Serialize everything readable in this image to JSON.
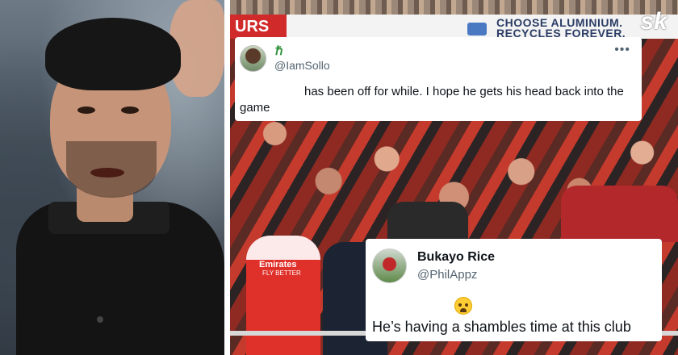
{
  "tweets": [
    {
      "badge": "ℏ",
      "handle": "@IamSollo",
      "more_label": "•••",
      "text": "has been off for while. I hope he gets his head back into the game"
    },
    {
      "name": "Bukayo Rice",
      "handle": "@PhilAppz",
      "emoji": "loudly-crying-face-icon",
      "text": "He’s having a shambles time at this club"
    }
  ],
  "background": {
    "banner_left_text": "URS",
    "banner_text": "CHOOSE ALUMINIUM. RECYCLES FOREVER.",
    "logo_text": "sk",
    "shirt_sponsor": "Emirates",
    "shirt_sponsor_line2": "FLY BETTER"
  },
  "colors": {
    "arsenal_red": "#e0302a",
    "twitter_text": "#0f1419",
    "twitter_secondary": "#536471"
  }
}
